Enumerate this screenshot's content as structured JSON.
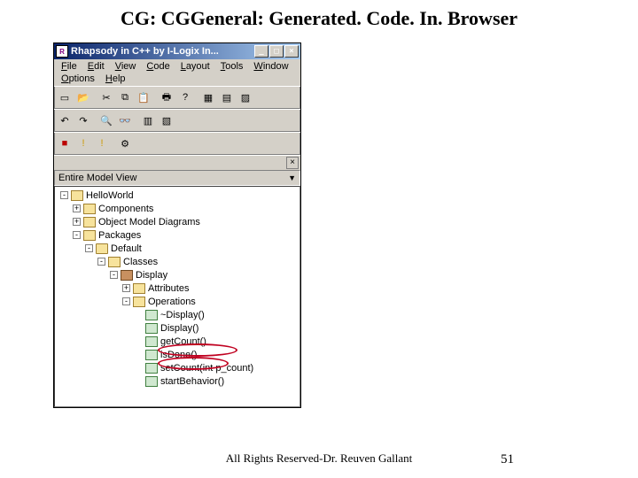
{
  "slide": {
    "title": "CG: CGGeneral: Generated. Code. In. Browser",
    "footer": "All Rights Reserved-Dr. Reuven Gallant",
    "page": "51"
  },
  "window": {
    "title": "Rhapsody in C++ by I-Logix In...",
    "icon_glyph": "R"
  },
  "menu": [
    "File",
    "Edit",
    "View",
    "Code",
    "Layout",
    "Tools",
    "Window",
    "Options",
    "Help"
  ],
  "browser": {
    "view_label": "Entire Model View"
  },
  "tree": [
    {
      "depth": 0,
      "exp": "-",
      "icon": "folder",
      "label": "HelloWorld"
    },
    {
      "depth": 1,
      "exp": "+",
      "icon": "folder",
      "label": "Components"
    },
    {
      "depth": 1,
      "exp": "+",
      "icon": "folder",
      "label": "Object Model Diagrams"
    },
    {
      "depth": 1,
      "exp": "-",
      "icon": "folder",
      "label": "Packages"
    },
    {
      "depth": 2,
      "exp": "-",
      "icon": "pkg",
      "label": "Default"
    },
    {
      "depth": 3,
      "exp": "-",
      "icon": "folder",
      "label": "Classes"
    },
    {
      "depth": 4,
      "exp": "-",
      "icon": "class",
      "label": "Display"
    },
    {
      "depth": 5,
      "exp": "+",
      "icon": "folder",
      "label": "Attributes"
    },
    {
      "depth": 5,
      "exp": "-",
      "icon": "folder",
      "label": "Operations"
    },
    {
      "depth": 6,
      "exp": " ",
      "icon": "op",
      "label": "~Display()"
    },
    {
      "depth": 6,
      "exp": " ",
      "icon": "op",
      "label": "Display()"
    },
    {
      "depth": 6,
      "exp": " ",
      "icon": "op",
      "label": "getCount()"
    },
    {
      "depth": 6,
      "exp": " ",
      "icon": "op",
      "label": "isDone()"
    },
    {
      "depth": 6,
      "exp": " ",
      "icon": "op",
      "label": "setCount(int p_count)"
    },
    {
      "depth": 6,
      "exp": " ",
      "icon": "op",
      "label": "startBehavior()"
    }
  ],
  "highlighted_ops": [
    "getCount()",
    "isDone()"
  ]
}
